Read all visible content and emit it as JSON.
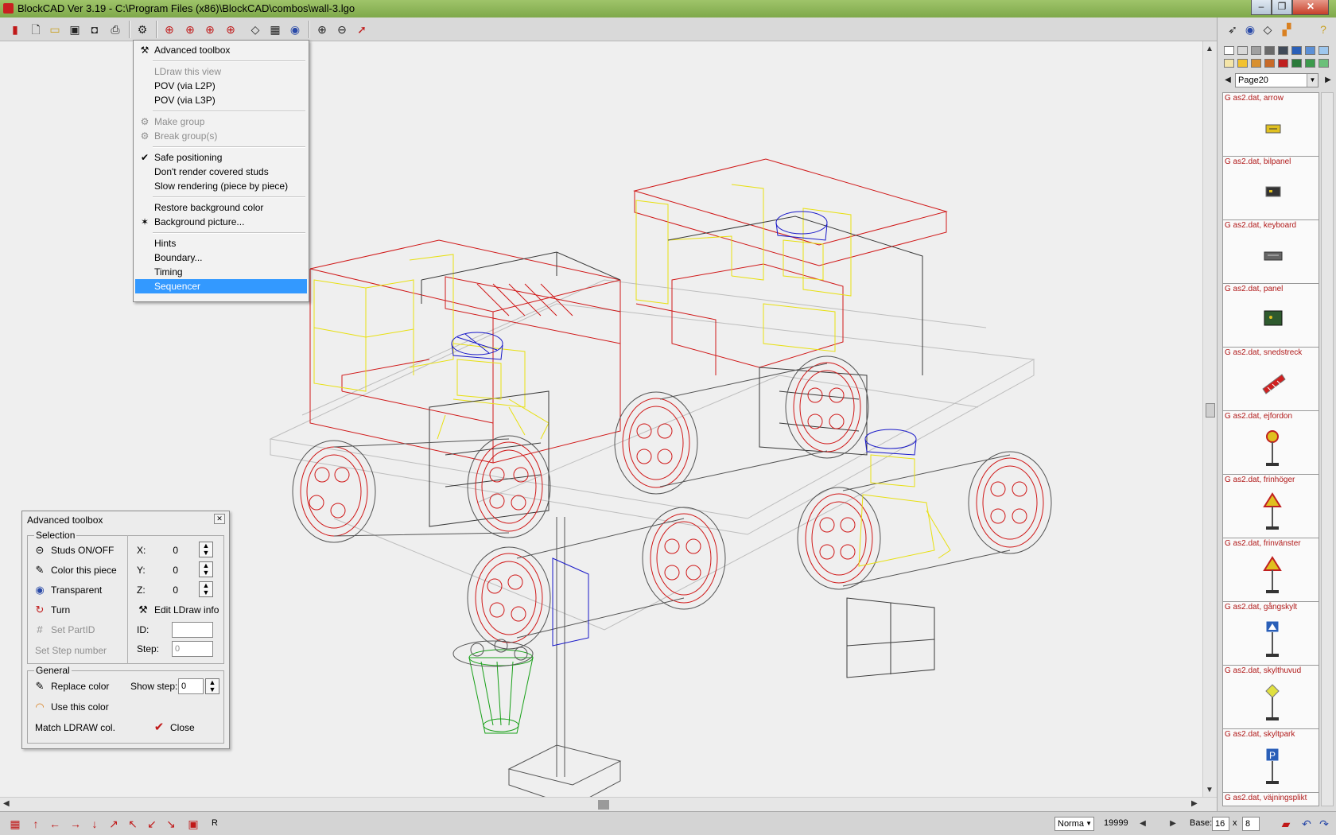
{
  "window": {
    "title": "BlockCAD Ver 3.19 - C:\\Program Files (x86)\\BlockCAD\\combos\\wall-3.lgo",
    "min": "–",
    "max": "❐",
    "close": "✕"
  },
  "toolbar": {
    "icons": [
      "exit-icon",
      "new-icon",
      "open-icon",
      "save-icon",
      "camera-icon",
      "print-icon",
      "settings-icon",
      "rotate-left-icon",
      "rotate-up-icon",
      "rotate-down-icon",
      "rotate-right-icon",
      "view-icon",
      "wireframe-icon",
      "eye-icon",
      "zoom-in-icon",
      "zoom-out-icon",
      "pointer-icon"
    ],
    "right_icons": [
      "select-icon",
      "eye-icon",
      "brick-icon",
      "rainbow-icon",
      "help-icon"
    ]
  },
  "menu": {
    "items": [
      {
        "label": "Advanced toolbox",
        "icon": "⚒",
        "state": "normal"
      },
      {
        "sep": true
      },
      {
        "label": "LDraw this view",
        "state": "disabled"
      },
      {
        "label": "POV (via L2P)",
        "state": "normal"
      },
      {
        "label": "POV (via L3P)",
        "state": "normal"
      },
      {
        "sep": true
      },
      {
        "label": "Make group",
        "icon": "⚙",
        "state": "disabled"
      },
      {
        "label": "Break group(s)",
        "icon": "⚙",
        "state": "disabled"
      },
      {
        "sep": true
      },
      {
        "label": "Safe positioning",
        "icon": "✔",
        "state": "normal"
      },
      {
        "label": "Don't render covered studs",
        "state": "normal"
      },
      {
        "label": "Slow rendering (piece by piece)",
        "state": "normal"
      },
      {
        "sep": true
      },
      {
        "label": "Restore background color",
        "state": "normal"
      },
      {
        "label": "Background picture...",
        "icon": "✶",
        "state": "normal"
      },
      {
        "sep": true
      },
      {
        "label": "Hints",
        "state": "normal"
      },
      {
        "label": "Boundary...",
        "state": "normal"
      },
      {
        "label": "Timing",
        "state": "normal"
      },
      {
        "label": "Sequencer",
        "state": "selected"
      }
    ]
  },
  "toolbox": {
    "title": "Advanced toolbox",
    "close": "✕",
    "selection_label": "Selection",
    "general_label": "General",
    "studs": "Studs ON/OFF",
    "color_piece": "Color this piece",
    "transparent": "Transparent",
    "turn": "Turn",
    "set_partid": "Set PartID",
    "set_step": "Set Step number",
    "x_label": "X:",
    "y_label": "Y:",
    "z_label": "Z:",
    "x_val": "0",
    "y_val": "0",
    "z_val": "0",
    "edit_ldraw": "Edit LDraw info",
    "id_label": "ID:",
    "id_val": "",
    "step_label": "Step:",
    "step_val": "0",
    "replace_color": "Replace color",
    "show_step": "Show step:",
    "show_step_val": "0",
    "use_color": "Use this color",
    "match_ldraw": "Match LDRAW col.",
    "close_label": "Close"
  },
  "palette": {
    "swatches": [
      "#ffffff",
      "#d8d8d8",
      "#a0a0a0",
      "#6a6a6a",
      "#404a58",
      "#2a5fb8",
      "#5b8fd6",
      "#9ec7ee",
      "#f4e5a8",
      "#f2c230",
      "#d89030",
      "#c86a28",
      "#c02020",
      "#2a7a3a",
      "#3c9a4c",
      "#6cc07a"
    ],
    "page": "Page20"
  },
  "parts": [
    {
      "name": "G as2.dat, arrow",
      "thumb": "arrow"
    },
    {
      "name": "G as2.dat, bilpanel",
      "thumb": "panel"
    },
    {
      "name": "G as2.dat, keyboard",
      "thumb": "keyboard"
    },
    {
      "name": "G as2.dat, panel",
      "thumb": "greenpanel"
    },
    {
      "name": "G as2.dat, snedstreck",
      "thumb": "stripe"
    },
    {
      "name": "G as2.dat, ejfordon",
      "thumb": "sign-round"
    },
    {
      "name": "G as2.dat, frinhöger",
      "thumb": "sign-tri"
    },
    {
      "name": "G as2.dat, frinvänster",
      "thumb": "sign-tri"
    },
    {
      "name": "G as2.dat, gångskylt",
      "thumb": "sign-blue"
    },
    {
      "name": "G as2.dat, skylthuvud",
      "thumb": "sign-diamond"
    },
    {
      "name": "G as2.dat, skyltpark",
      "thumb": "sign-park"
    },
    {
      "name": "G as2.dat, väjningsplikt",
      "thumb": "sign-tri"
    }
  ],
  "statusbar": {
    "render_mode": "Norma",
    "counter": "19999",
    "base_label": "Base:",
    "base_x": "16",
    "x_sep": "x",
    "base_y": "8",
    "r_label": "R"
  },
  "colors": {
    "wire_red": "#d01818",
    "wire_yellow": "#e8e010",
    "wire_blue": "#1818c8",
    "wire_black": "#303030",
    "wire_green": "#18a018",
    "menu_highlight": "#3399ff"
  }
}
